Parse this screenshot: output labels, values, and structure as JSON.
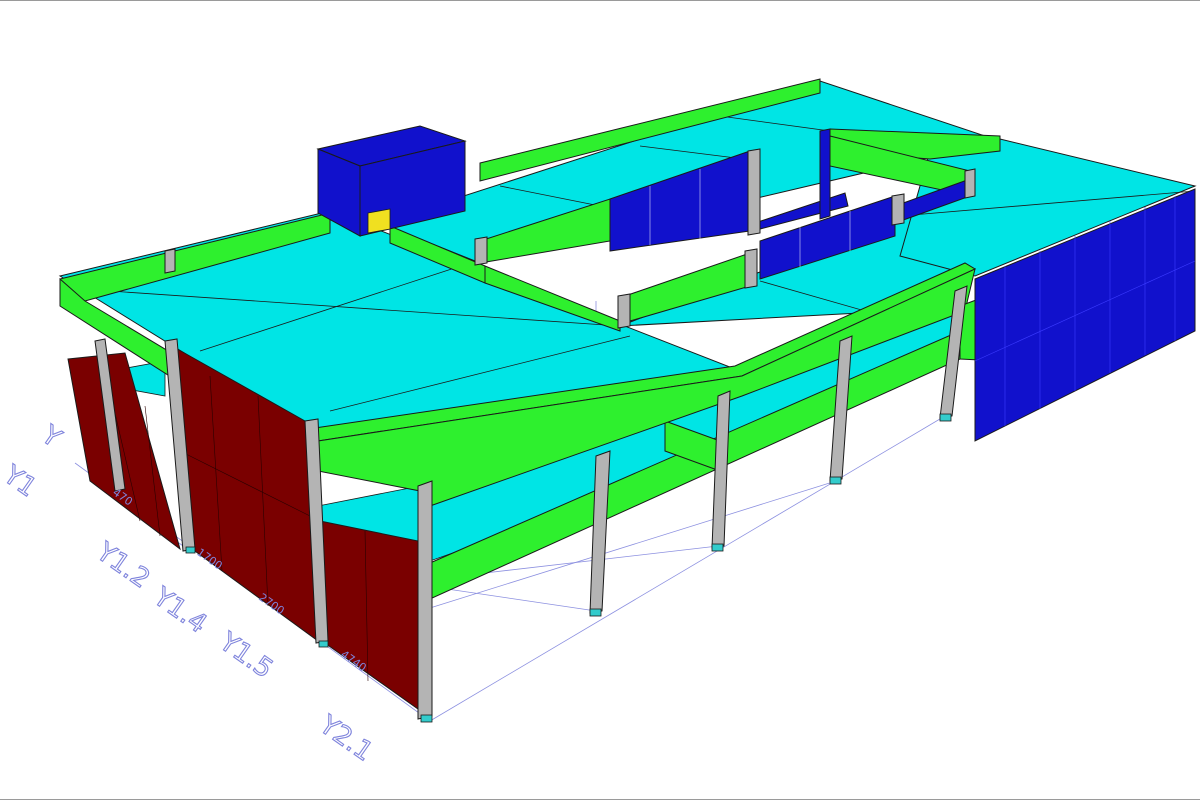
{
  "colors": {
    "slab": "#00e5e5",
    "beam": "#2ef02e",
    "column": "#b4b4b4",
    "wall": "#7a0000",
    "core": "#1111cc",
    "grid_text": "#7f84dc",
    "support": "#33cccc"
  },
  "grid": {
    "axis_top_a": "Y",
    "axis_top_b": "Y1",
    "y1_2": "Y1.2",
    "y1_4": "Y1.4",
    "y1_5": "Y1.5",
    "y2_1": "Y2.1"
  },
  "dimensions": {
    "d1": "470",
    "d2": "1700",
    "d3": "2700",
    "d4": "4740"
  }
}
